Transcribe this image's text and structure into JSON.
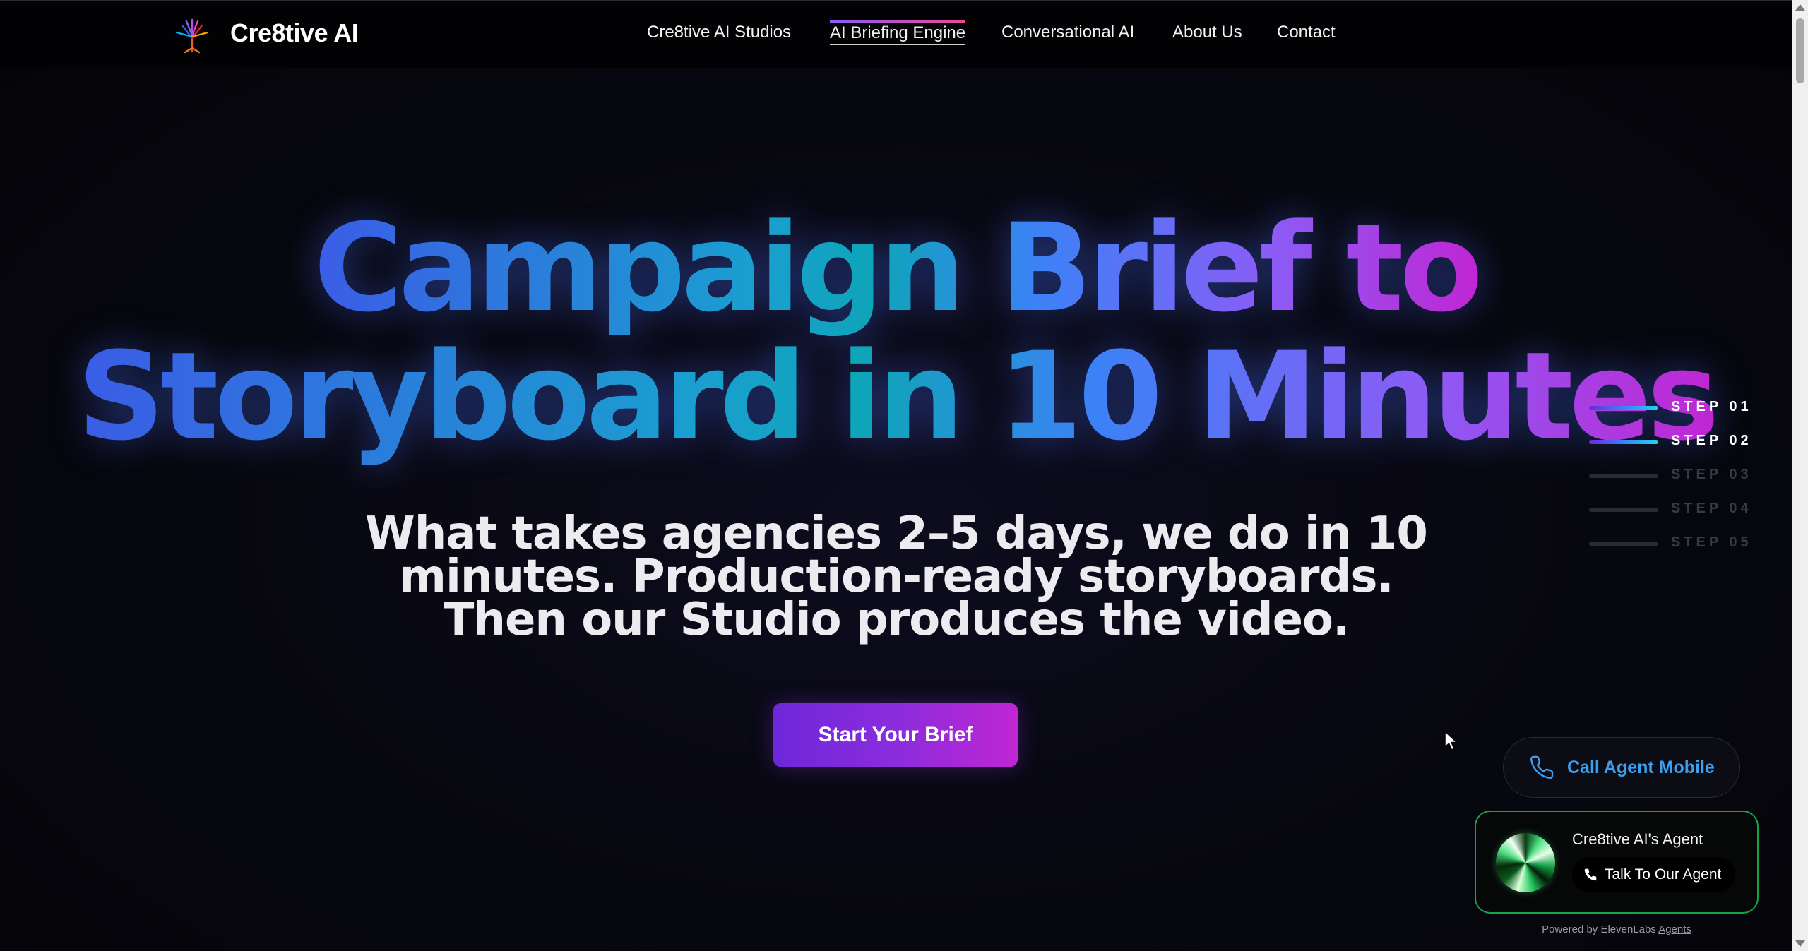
{
  "header": {
    "brand": "Cre8tive AI",
    "nav": [
      {
        "label": "Cre8tive AI Studios",
        "active": false
      },
      {
        "label": "AI Briefing Engine",
        "active": true
      },
      {
        "label": "Conversational AI",
        "active": false
      },
      {
        "label": "About Us",
        "active": false
      },
      {
        "label": "Contact",
        "active": false
      }
    ]
  },
  "hero": {
    "headline_line1": "Campaign Brief to",
    "headline_line2": "Storyboard in 10 Minutes",
    "subhead_lines": [
      "What takes agencies 2–5 days, we do in 10",
      "minutes. Production-ready storyboards.",
      "Then our Studio produces the video."
    ],
    "cta_label": "Start Your Brief"
  },
  "steps": [
    {
      "label": "STEP 01",
      "active": true
    },
    {
      "label": "STEP 02",
      "active": true
    },
    {
      "label": "STEP 03",
      "active": false
    },
    {
      "label": "STEP 04",
      "active": false
    },
    {
      "label": "STEP 05",
      "active": false
    }
  ],
  "call_agent": {
    "label": "Call Agent Mobile",
    "icon": "phone-icon"
  },
  "agent_widget": {
    "title": "Cre8tive AI's Agent",
    "button_label": "Talk To Our Agent",
    "powered_prefix": "Powered by ElevenLabs",
    "powered_link": "Agents"
  },
  "colors": {
    "accent_purple": "#6d28d9",
    "accent_magenta": "#c026d3",
    "accent_blue": "#3b82f6",
    "accent_cyan": "#0ea5b8",
    "agent_green": "#16a34a",
    "call_text": "#3aa0ef"
  }
}
